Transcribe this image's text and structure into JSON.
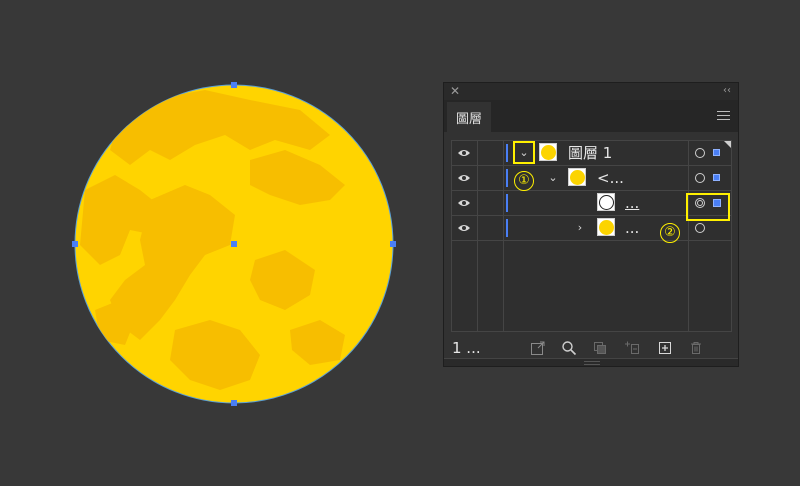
{
  "panel": {
    "close_glyph": "✕",
    "collapse_glyph": "‹‹",
    "tab_label": "圖層",
    "layer_count": "1 ...",
    "rows": [
      {
        "name": "圖層 1",
        "kind": "layer",
        "icon": "eye-icon"
      },
      {
        "name": "<...",
        "kind": "group",
        "icon": "eye-icon"
      },
      {
        "name": "...",
        "kind": "path",
        "icon": "eye-icon"
      },
      {
        "name": "...",
        "kind": "group",
        "icon": "eye-icon"
      }
    ],
    "callouts": {
      "first": "①",
      "second": "②"
    }
  },
  "colors": {
    "background": "#383838",
    "moon_fill": "#ffd400",
    "moon_spots": "#f7be00",
    "selection": "#4a7ff5",
    "highlight": "#fff000"
  }
}
